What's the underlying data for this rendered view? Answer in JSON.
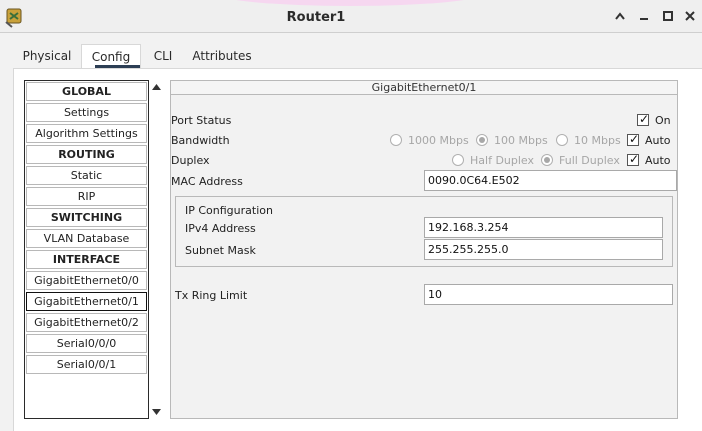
{
  "window": {
    "title": "Router1",
    "buttons": [
      "chevron-up-icon",
      "minimize-icon",
      "maximize-icon",
      "close-icon"
    ]
  },
  "tabs": [
    {
      "label": "Physical"
    },
    {
      "label": "Config"
    },
    {
      "label": "CLI"
    },
    {
      "label": "Attributes"
    }
  ],
  "sidebar": {
    "items": [
      {
        "label": "GLOBAL",
        "type": "section"
      },
      {
        "label": "Settings"
      },
      {
        "label": "Algorithm Settings"
      },
      {
        "label": "ROUTING",
        "type": "section"
      },
      {
        "label": "Static"
      },
      {
        "label": "RIP"
      },
      {
        "label": "SWITCHING",
        "type": "section"
      },
      {
        "label": "VLAN Database"
      },
      {
        "label": "INTERFACE",
        "type": "section"
      },
      {
        "label": "GigabitEthernet0/0"
      },
      {
        "label": "GigabitEthernet0/1",
        "selected": true
      },
      {
        "label": "GigabitEthernet0/2"
      },
      {
        "label": "Serial0/0/0"
      },
      {
        "label": "Serial0/0/1"
      }
    ]
  },
  "panel": {
    "title": "GigabitEthernet0/1",
    "port_status": {
      "label": "Port Status",
      "on_label": "On",
      "on_checked": true
    },
    "bandwidth": {
      "label": "Bandwidth",
      "options": [
        "1000 Mbps",
        "100 Mbps",
        "10 Mbps"
      ],
      "selected": "100 Mbps",
      "auto_label": "Auto",
      "auto_checked": true
    },
    "duplex": {
      "label": "Duplex",
      "options": [
        "Half Duplex",
        "Full Duplex"
      ],
      "selected": "Full Duplex",
      "auto_label": "Auto",
      "auto_checked": true
    },
    "mac": {
      "label": "MAC Address",
      "value": "0090.0C64.E502"
    },
    "ip_config": {
      "title": "IP Configuration",
      "ipv4_label": "IPv4 Address",
      "ipv4_value": "192.168.3.254",
      "mask_label": "Subnet Mask",
      "mask_value": "255.255.255.0"
    },
    "tx_ring": {
      "label": "Tx Ring Limit",
      "value": "10"
    }
  },
  "colors": {
    "tab_underline": "#2c3e54",
    "title_highlight": "#f6d7f0"
  }
}
